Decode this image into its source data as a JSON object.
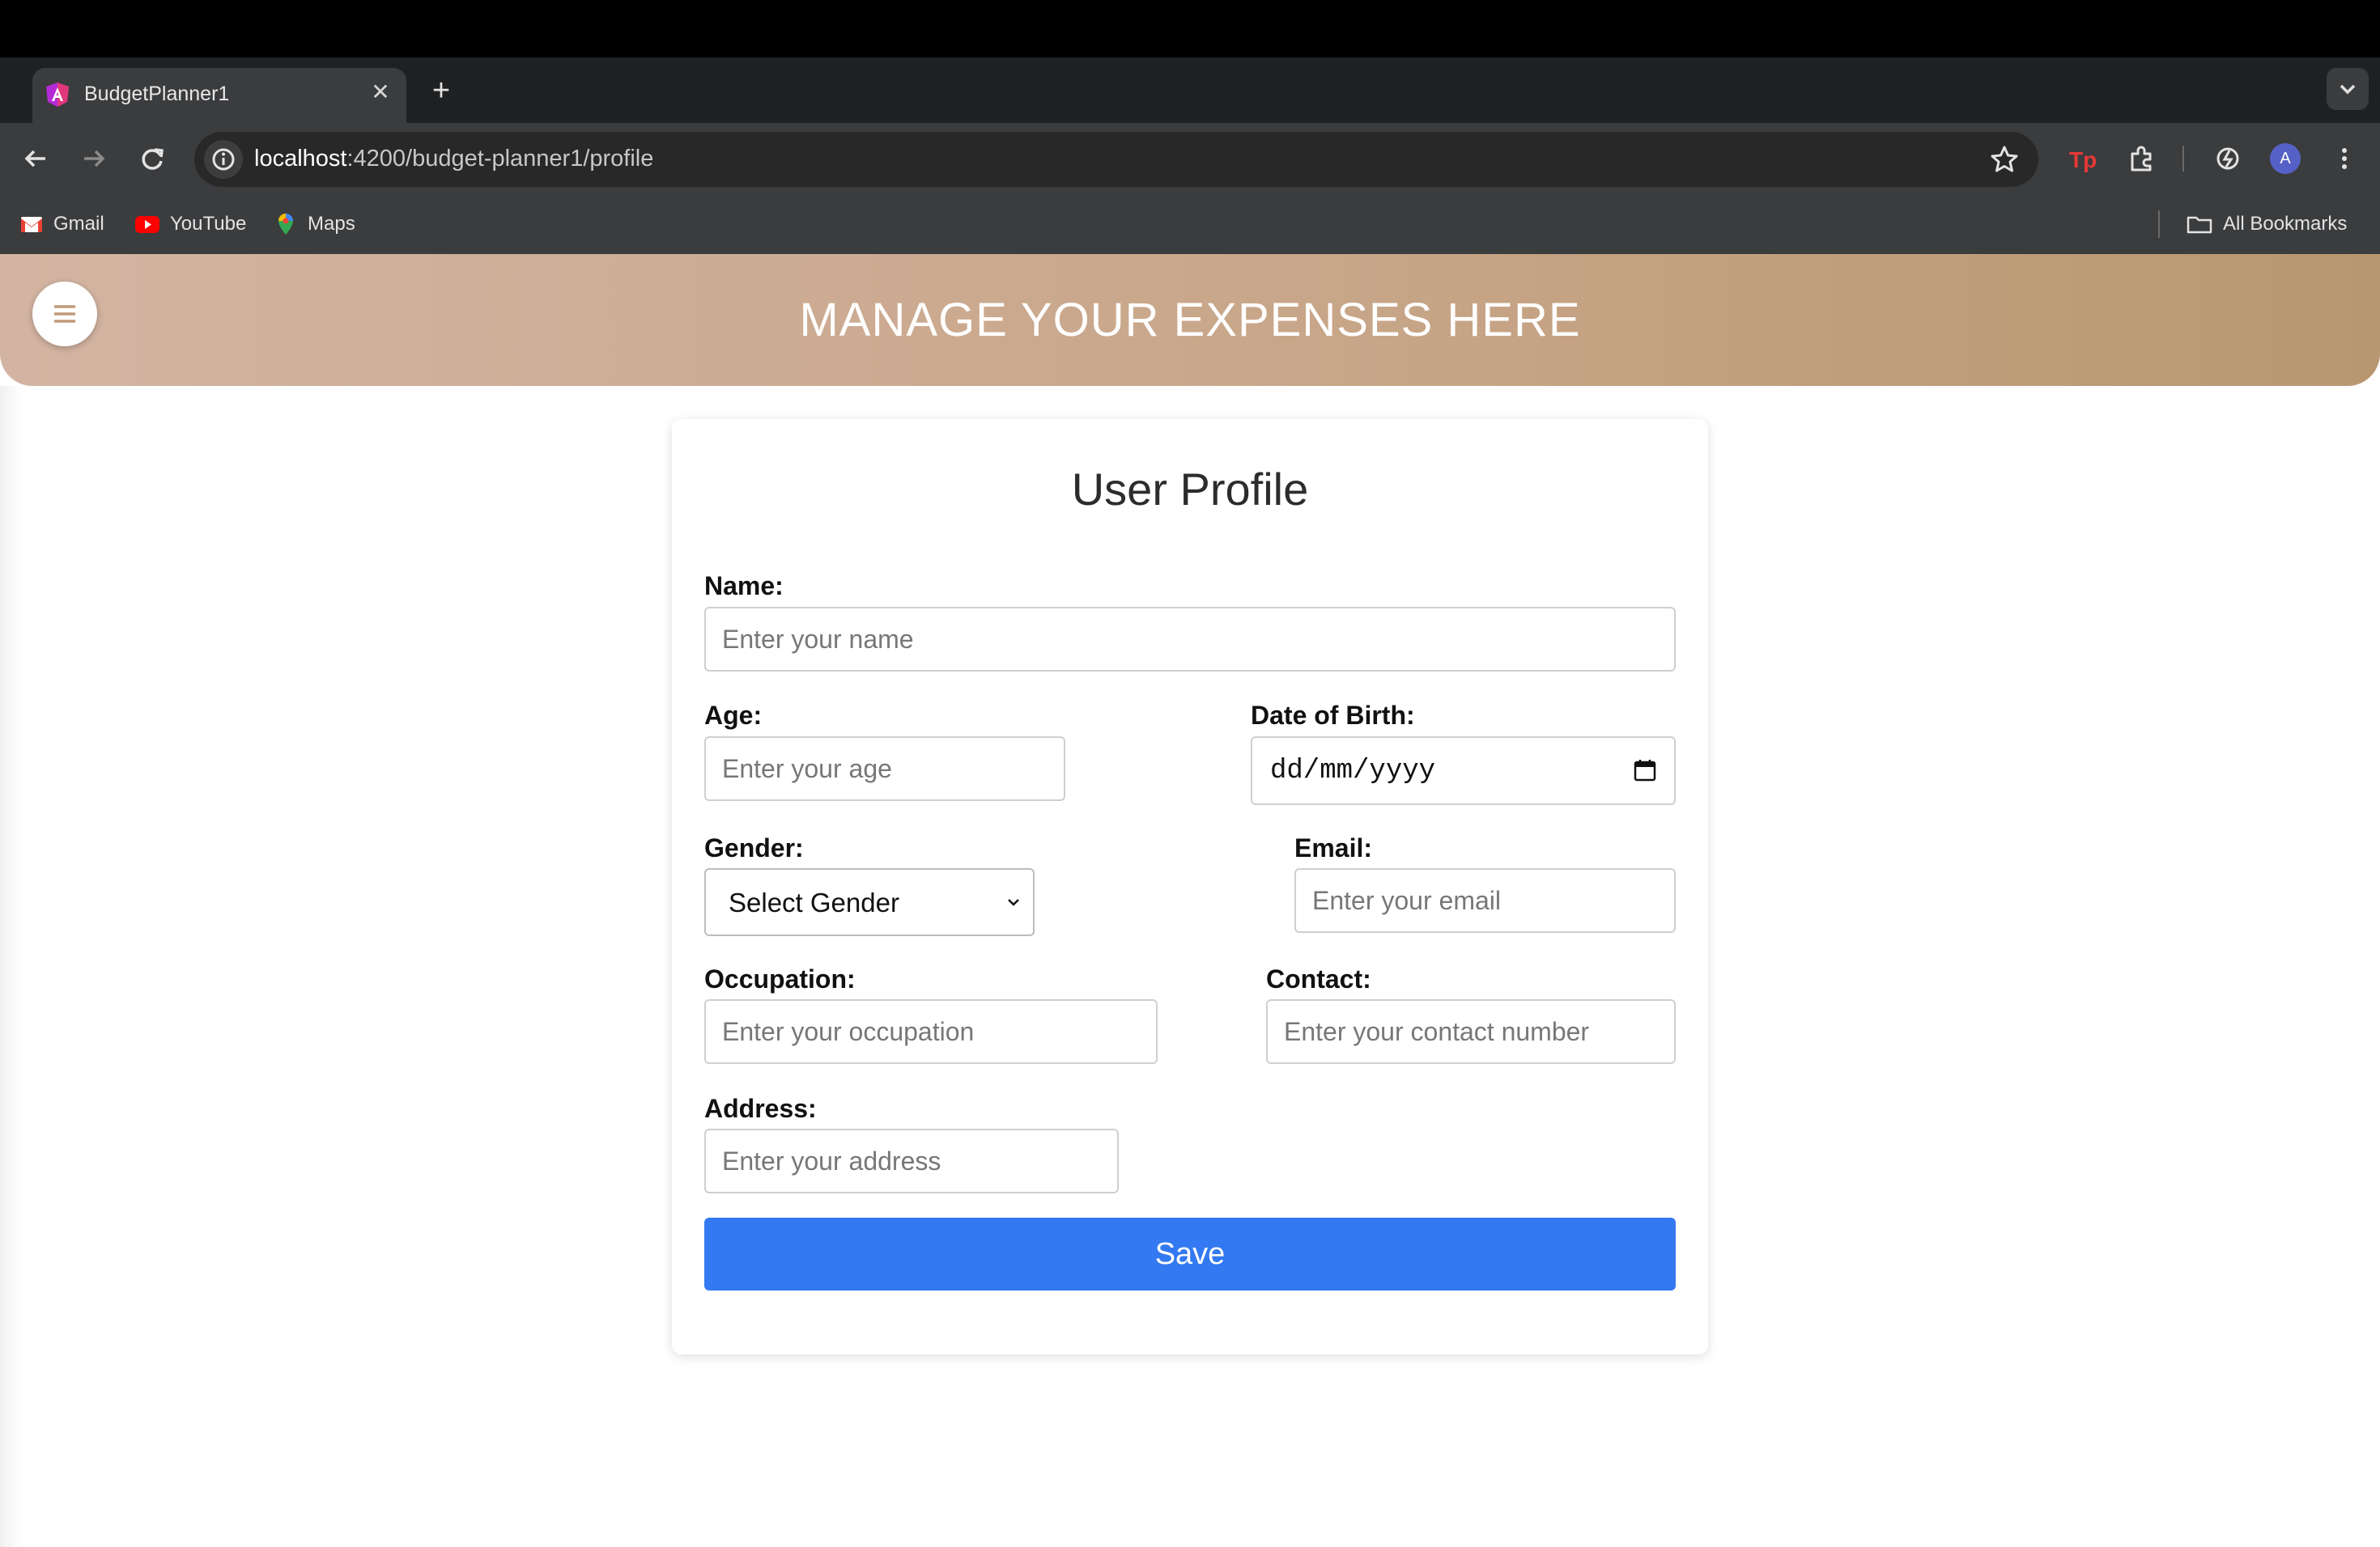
{
  "browser": {
    "tab": {
      "title": "BudgetPlanner1",
      "close_glyph": "✕"
    },
    "new_tab_glyph": "+",
    "url": {
      "host": "localhost",
      "path": ":4200/budget-planner1/profile"
    },
    "avatar_letter": "A",
    "bookmarks": [
      {
        "label": "Gmail",
        "icon": "gmail-icon"
      },
      {
        "label": "YouTube",
        "icon": "youtube-icon"
      },
      {
        "label": "Maps",
        "icon": "maps-icon"
      }
    ],
    "all_bookmarks": "All Bookmarks"
  },
  "app": {
    "header_title": "MANAGE YOUR EXPENSES HERE",
    "accent_color": "#3379f1"
  },
  "profile": {
    "title": "User Profile",
    "name": {
      "label": "Name:",
      "placeholder": "Enter your name"
    },
    "age": {
      "label": "Age:",
      "placeholder": "Enter your age"
    },
    "dob": {
      "label": "Date of Birth:",
      "placeholder": "dd/mm/yyyy"
    },
    "gender": {
      "label": "Gender:",
      "selected": "Select Gender"
    },
    "email": {
      "label": "Email:",
      "placeholder": "Enter your email"
    },
    "occupation": {
      "label": "Occupation:",
      "placeholder": "Enter your occupation"
    },
    "contact": {
      "label": "Contact:",
      "placeholder": "Enter your contact number"
    },
    "address": {
      "label": "Address:",
      "placeholder": "Enter your address"
    },
    "save_label": "Save"
  }
}
